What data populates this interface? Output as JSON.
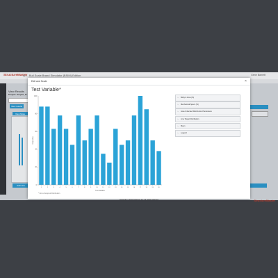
{
  "app": {
    "brand": "StructureMaster",
    "title": "Q1 - Bull Scale Brand Simulator (BSIM) Edition",
    "user": "Gene Barnett",
    "view_title": "View Results",
    "view_subtitle": "Project: Project_2 / Sur...",
    "footer_brand": "StructureMaster",
    "copyright": "Copyright © 2013 Structure Inc. All rights reserved.",
    "buttons": {
      "new_results": "View results",
      "view_all": "View More",
      "add_line": "Add Line"
    }
  },
  "modal": {
    "title": "Edit and Scale",
    "close_label": "×",
    "chart_title": "Test Variable*",
    "note": "* Not a Sampled Distribution",
    "accordion": [
      {
        "label": "Body & Area (%)",
        "icon": "chevron-right-icon"
      },
      {
        "label": "Mechanical Specs (%)",
        "icon": "chevron-right-icon"
      },
      {
        "label": "Area Unlocked Distribution Parameters",
        "icon": "chevron-right-icon"
      },
      {
        "label": "Line Target Distribution",
        "icon": "chevron-right-icon"
      },
      {
        "label": "Mean",
        "icon": "chevron-right-icon"
      },
      {
        "label": "Legend",
        "icon": "chevron-right-icon"
      }
    ]
  },
  "chart_data": {
    "type": "bar",
    "title": "Test Variable*",
    "xlabel": "Test Variable",
    "ylabel": "Frequency",
    "ylim": [
      0,
      100
    ],
    "yticks": [
      0,
      20,
      40,
      60,
      80,
      100
    ],
    "categories": [
      "1",
      "2",
      "3",
      "4",
      "5",
      "6",
      "7",
      "8",
      "9",
      "10",
      "11",
      "12",
      "13",
      "14",
      "15",
      "16",
      "17",
      "18",
      "19",
      "20"
    ],
    "values": [
      88,
      88,
      63,
      78,
      63,
      45,
      78,
      50,
      63,
      78,
      35,
      25,
      63,
      45,
      50,
      78,
      100,
      85,
      50,
      38
    ],
    "bar_color": "#2ba3d7",
    "grid": false
  }
}
